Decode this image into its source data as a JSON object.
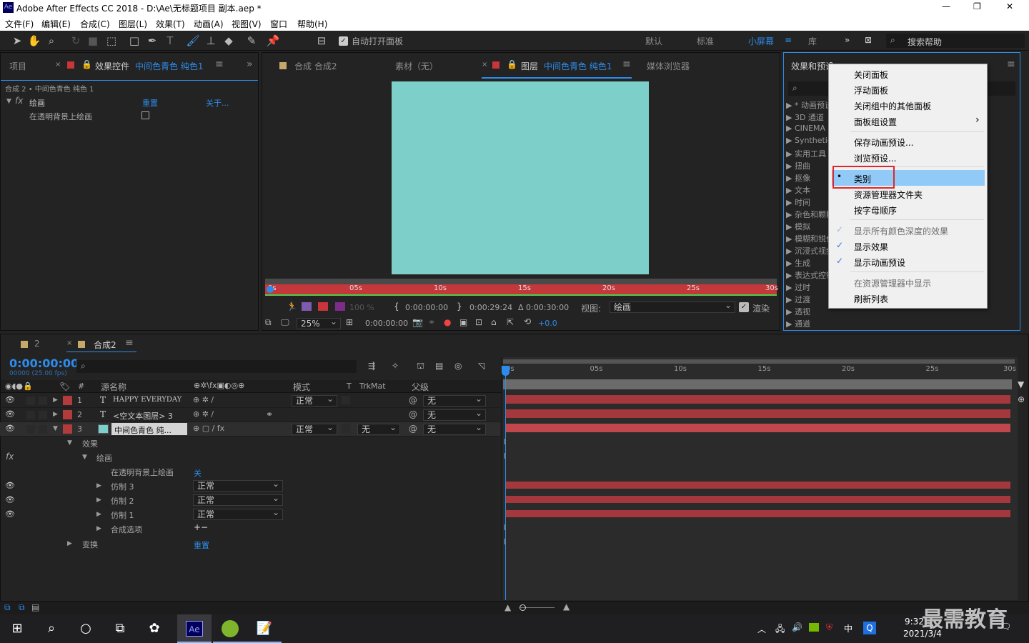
{
  "titlebar": {
    "title": "Adobe After Effects CC 2018 - D:\\Ae\\无标题项目 副本.aep *",
    "min": "—",
    "max": "❐",
    "close": "✕"
  },
  "menu": [
    "文件(F)",
    "编辑(E)",
    "合成(C)",
    "图层(L)",
    "效果(T)",
    "动画(A)",
    "视图(V)",
    "窗口",
    "帮助(H)"
  ],
  "toolbar": {
    "auto_open": "自动打开面板",
    "workspaces": [
      "默认",
      "标准",
      "小屏幕",
      "库"
    ],
    "active_ws": "小屏幕",
    "search": "搜索帮助"
  },
  "left_panel": {
    "tab_project": "项目",
    "tab_effects_prefix": "效果控件",
    "tab_effects_layer": "中间色青色 纯色1",
    "breadcrumb": "合成 2 • 中间色青色 纯色 1",
    "effect_name": "绘画",
    "reset": "重置",
    "about": "关于...",
    "prop": "在透明背景上绘画"
  },
  "viewer": {
    "tab_comp": "合成 合成2",
    "tab_footage": "素材（无）",
    "tab_layer_prefix": "图层",
    "tab_layer_name": "中间色青色 纯色1",
    "tab_browser": "媒体浏览器",
    "solid_color": "#7dd0ca",
    "ruler": [
      "0s",
      "05s",
      "10s",
      "15s",
      "20s",
      "25s",
      "30s"
    ],
    "opacity": "100 %",
    "in_time": "0:00:00:00",
    "out_time": "0:00:29:24",
    "dur": "Δ 0:00:30:00",
    "view_label": "视图:",
    "view_value": "绘画",
    "render": "渲染",
    "zoom": "25%",
    "cur_time": "0:00:00:00",
    "exposure": "+0.0"
  },
  "effects_panel": {
    "title": "效果和预设",
    "items": [
      "* 动画预设",
      "3D 通道",
      "CINEMA 4D",
      "Synthetic",
      "实用工具",
      "扭曲",
      "抠像",
      "文本",
      "时间",
      "杂色和颗粒",
      "模拟",
      "模糊和锐化",
      "沉浸式视频",
      "生成",
      "表达式控制",
      "过时",
      "过渡",
      "透视",
      "通道"
    ]
  },
  "context_menu": {
    "items": [
      "关闭面板",
      "浮动面板",
      "关闭组中的其他面板",
      "面板组设置",
      "保存动画预设...",
      "浏览预设...",
      "类别",
      "资源管理器文件夹",
      "按字母顺序",
      "显示所有颜色深度的效果",
      "显示效果",
      "显示动画预设",
      "在资源管理器中显示",
      "刷新列表"
    ],
    "selected": "类别",
    "submenu_arrow": "›"
  },
  "timeline": {
    "tab_render": "2",
    "tab_comp": "合成2",
    "timecode": "0:00:00:00",
    "fps": "00000 (25.00 fps)",
    "col_num": "#",
    "col_name": "源名称",
    "col_mode": "模式",
    "col_t": "T",
    "col_trk": "TrkMat",
    "col_parent": "父级",
    "layers": [
      {
        "num": "1",
        "type": "T",
        "name": "HAPPY EVERYDAY",
        "mode": "正常",
        "parent": "无"
      },
      {
        "num": "2",
        "type": "T",
        "name": "<空文本图层> 3",
        "mode": "",
        "parent": "无"
      },
      {
        "num": "3",
        "type": "",
        "name": "中间色青色 纯...",
        "mode": "正常",
        "trk": "无",
        "parent": "无"
      }
    ],
    "sub": {
      "effects": "效果",
      "paint": "绘画",
      "paint_prop": "在透明背景上绘画",
      "paint_val": "关",
      "clone3": "仿制 3",
      "clone2": "仿制 2",
      "clone1": "仿制 1",
      "blend": "正常",
      "comp_opts": "合成选项",
      "transform": "变换",
      "reset": "重置",
      "plus_minus": "+−"
    },
    "ticks": [
      "0s",
      "05s",
      "10s",
      "15s",
      "20s",
      "25s",
      "30s"
    ]
  },
  "taskbar": {
    "time": "9:32",
    "date": "2021/3/4",
    "ime": "中",
    "watermark": "最需教育"
  }
}
